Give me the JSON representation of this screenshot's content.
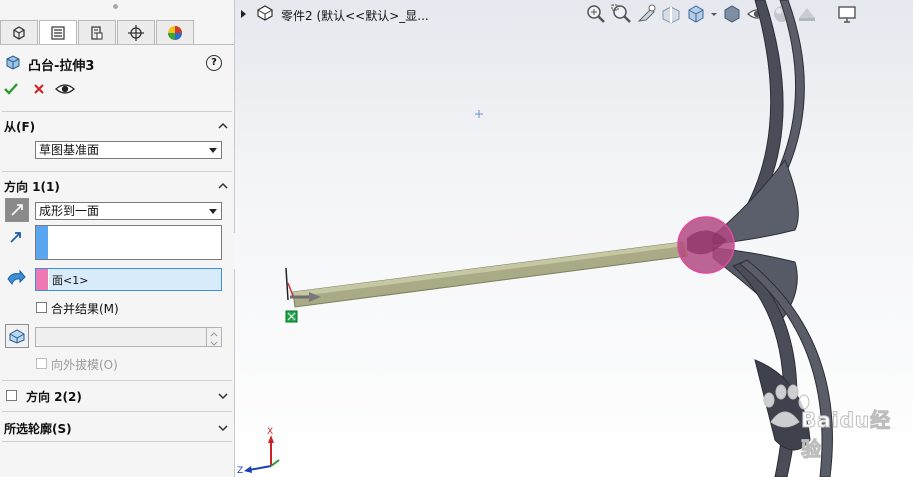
{
  "property_manager": {
    "feature_title": "凸台-拉伸3",
    "help_glyph": "?",
    "from_section": {
      "label": "从(F)",
      "start_condition": "草图基准面"
    },
    "direction1_section": {
      "label": "方向 1(1)",
      "end_condition": "成形到一面",
      "face_selection": "面<1>",
      "merge_result_label": "合并结果(M)",
      "merge_result_checked": false,
      "draft_outward_label": "向外拔模(O)",
      "draft_outward_checked": false
    },
    "direction2_section": {
      "label": "方向 2(2)",
      "checked": false
    },
    "selected_contours_section": {
      "label": "所选轮廓(S)"
    }
  },
  "graphics_area": {
    "breadcrumb_text": "零件2 (默认<<默认>_显...",
    "triad_labels": {
      "x": "X",
      "z": "Z"
    },
    "watermark_text": "Baidu经验"
  },
  "icons": [
    "featuremanager-icon",
    "propertymanager-icon",
    "configurationmanager-icon",
    "dimxpert-icon",
    "appearance-icon",
    "extrude-boss-icon",
    "ok-check-icon",
    "cancel-x-icon",
    "preview-eye-icon",
    "reverse-direction-icon",
    "face-direction-icon",
    "draft-icon",
    "zoom-to-fit-icon",
    "zoom-area-icon",
    "previous-view-icon",
    "section-view-icon",
    "view-orientation-icon",
    "display-style-icon",
    "hide-show-icon",
    "edit-appearance-icon",
    "scene-icon",
    "view-settings-icon"
  ],
  "colors": {
    "ok_check": "#2e9a2e",
    "cancel_x": "#d02020",
    "selection_blue": "#5aa6f0",
    "selection_pink": "#ee78b4",
    "highlight_magenta": "#c24a86",
    "extrude_bar": "#a9ab86",
    "model_gray": "#4a4d58"
  }
}
